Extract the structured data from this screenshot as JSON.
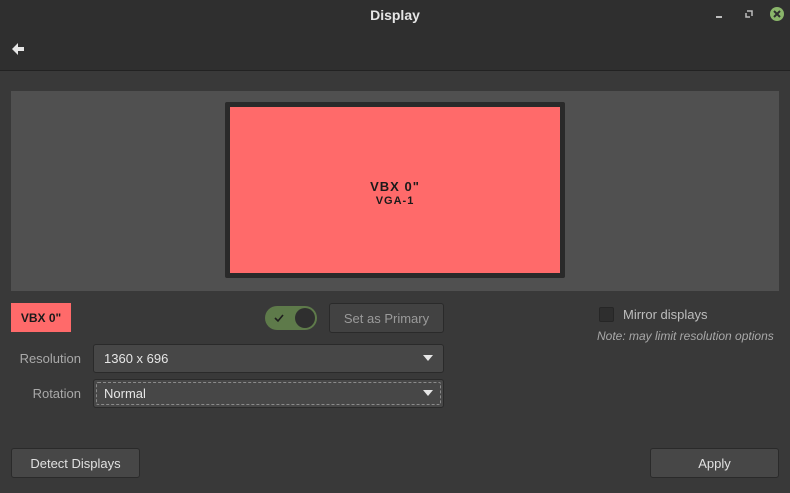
{
  "window": {
    "title": "Display"
  },
  "monitor": {
    "name": "VBX 0\"",
    "port": "VGA-1",
    "color": "#ff6a6a"
  },
  "chip": {
    "label": "VBX 0\""
  },
  "toggle": {
    "on": true
  },
  "buttons": {
    "set_primary": "Set as Primary",
    "detect": "Detect Displays",
    "apply": "Apply"
  },
  "mirror": {
    "label": "Mirror displays",
    "checked": false,
    "note": "Note: may limit resolution options"
  },
  "resolution": {
    "label": "Resolution",
    "value": "1360 x 696"
  },
  "rotation": {
    "label": "Rotation",
    "value": "Normal"
  },
  "colors": {
    "accent": "#5e7a4a",
    "close": "#8ab56a"
  }
}
